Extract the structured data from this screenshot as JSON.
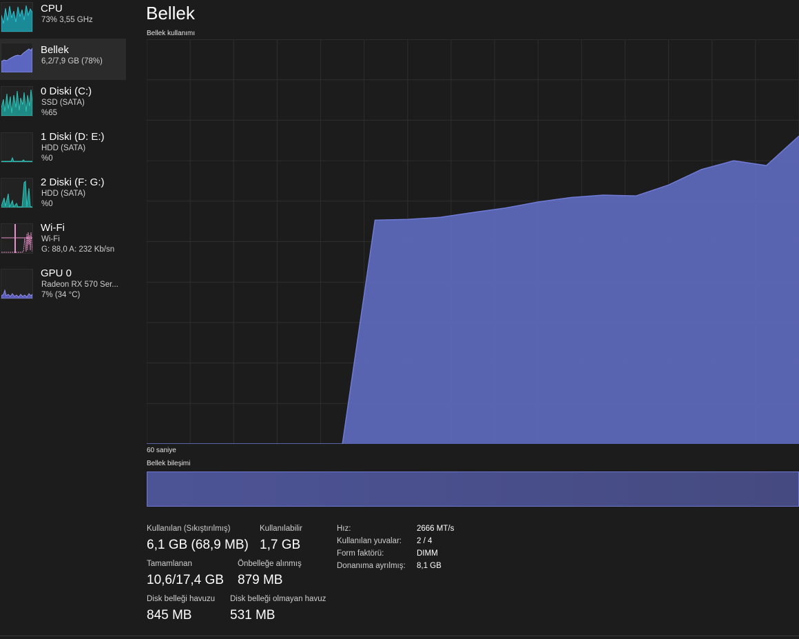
{
  "colors": {
    "background": "#1c1c1c",
    "selected_item": "#2b2b2b",
    "cpu_accent": "#17a2b8",
    "memory_accent": "#6f7bd6",
    "disk_accent": "#2aa39b",
    "wifi_accent": "#e890c8",
    "gpu_accent": "#7f7fd8"
  },
  "sidebar": {
    "items": [
      {
        "title": "CPU",
        "line1": "73%  3,55 GHz",
        "line2": "",
        "icon": "cpu-graph-icon"
      },
      {
        "title": "Bellek",
        "line1": "6,2/7,9 GB (78%)",
        "line2": "",
        "icon": "memory-graph-icon"
      },
      {
        "title": "0 Diski (C:)",
        "line1": "SSD (SATA)",
        "line2": "%65",
        "icon": "disk-graph-icon"
      },
      {
        "title": "1 Diski (D: E:)",
        "line1": "HDD (SATA)",
        "line2": "%0",
        "icon": "disk-graph-icon"
      },
      {
        "title": "2 Diski (F: G:)",
        "line1": "HDD (SATA)",
        "line2": "%0",
        "icon": "disk-graph-icon"
      },
      {
        "title": "Wi-Fi",
        "line1": "Wi-Fi",
        "line2": "G: 88,0  A: 232 Kb/sn",
        "icon": "wifi-graph-icon"
      },
      {
        "title": "GPU 0",
        "line1": "Radeon RX 570 Ser...",
        "line2": "7%  (34 °C)",
        "icon": "gpu-graph-icon"
      }
    ]
  },
  "main": {
    "title": "Bellek",
    "graph_label": "Bellek kullanımı",
    "time_label": "60 saniye",
    "composition_label": "Bellek bileşimi"
  },
  "chart_data": {
    "type": "area",
    "x": [
      60,
      57,
      54,
      51,
      48,
      45,
      42,
      39,
      36,
      33,
      30,
      27,
      24,
      21,
      18,
      15,
      12,
      9,
      6,
      3,
      0
    ],
    "series": [
      {
        "values": [
          0,
          0,
          0,
          0,
          0,
          0,
          0,
          55.3,
          55.5,
          56,
          57.2,
          58.3,
          59.8,
          60.9,
          61.5,
          61.3,
          64,
          67.8,
          70,
          68.8,
          76.1
        ]
      }
    ],
    "xlabel": "",
    "ylabel": "",
    "ylim": [
      0,
      100
    ],
    "xlim": [
      60,
      0
    ],
    "grid": true
  },
  "stats": {
    "used_label": "Kullanılan (Sıkıştırılmış)",
    "used_value": "6,1 GB (68,9 MB)",
    "available_label": "Kullanılabilir",
    "available_value": "1,7 GB",
    "committed_label": "Tamamlanan",
    "committed_value": "10,6/17,4 GB",
    "cached_label": "Önbelleğe alınmış",
    "cached_value": "879 MB",
    "paged_label": "Disk belleği havuzu",
    "paged_value": "845 MB",
    "nonpaged_label": "Disk belleği olmayan havuz",
    "nonpaged_value": "531 MB"
  },
  "details": [
    {
      "label": "Hız:",
      "value": "2666 MT/s"
    },
    {
      "label": "Kullanılan yuvalar:",
      "value": "2 / 4"
    },
    {
      "label": "Form faktörü:",
      "value": "DIMM"
    },
    {
      "label": "Donanıma ayrılmış:",
      "value": "8,1 GB"
    }
  ]
}
